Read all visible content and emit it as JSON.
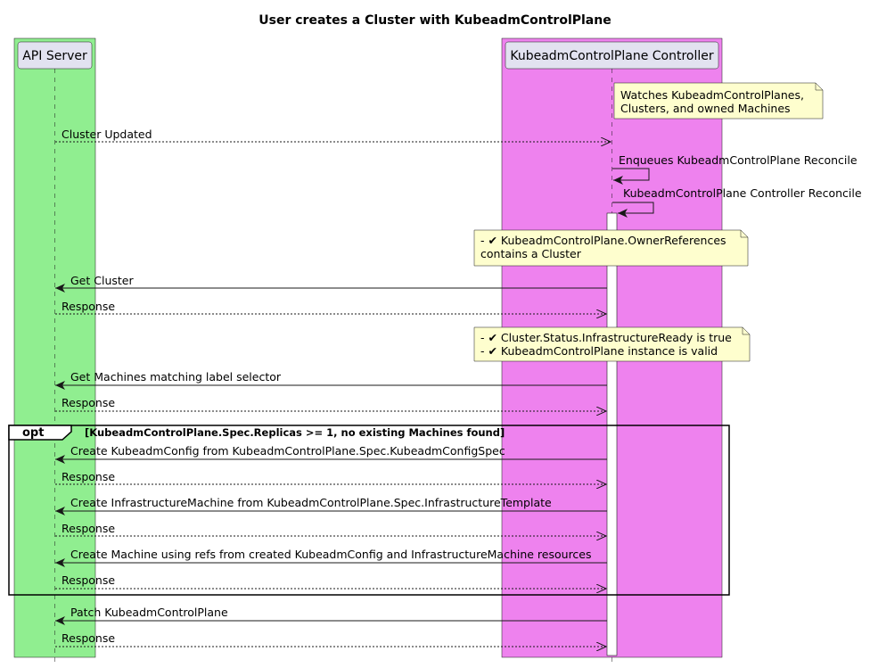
{
  "title": "User creates a Cluster with KubeadmControlPlane",
  "participants": {
    "api_server": "API Server",
    "controller": "KubeadmControlPlane Controller"
  },
  "colors": {
    "api_box": "#90ee90",
    "controller_box": "#ee82ee",
    "note_fill": "#fefece",
    "participant_fill": "#e2e2f0"
  },
  "notes": {
    "watches": [
      "Watches KubeadmControlPlanes,",
      "Clusters, and owned Machines"
    ],
    "owner_refs": [
      "- ✔ KubeadmControlPlane.OwnerReferences",
      "contains a Cluster"
    ],
    "infra_ready": [
      "- ✔ Cluster.Status.InfrastructureReady is true",
      "- ✔ KubeadmControlPlane instance is valid"
    ]
  },
  "messages": {
    "cluster_updated": "Cluster Updated",
    "enqueues": "Enqueues KubeadmControlPlane Reconcile",
    "reconcile": "KubeadmControlPlane Controller Reconcile",
    "get_cluster": "Get Cluster",
    "response_1": "Response",
    "get_machines": "Get Machines matching label selector",
    "response_2": "Response",
    "create_config": "Create KubeadmConfig from KubeadmControlPlane.Spec.KubeadmConfigSpec",
    "response_3": "Response",
    "create_infra": "Create InfrastructureMachine from KubeadmControlPlane.Spec.InfrastructureTemplate",
    "response_4": "Response",
    "create_machine": "Create Machine using refs from created KubeadmConfig and InfrastructureMachine resources",
    "response_5": "Response",
    "patch": "Patch KubeadmControlPlane",
    "response_6": "Response"
  },
  "opt": {
    "label": "opt",
    "condition": "[KubeadmControlPlane.Spec.Replicas >= 1, no existing Machines found]"
  }
}
